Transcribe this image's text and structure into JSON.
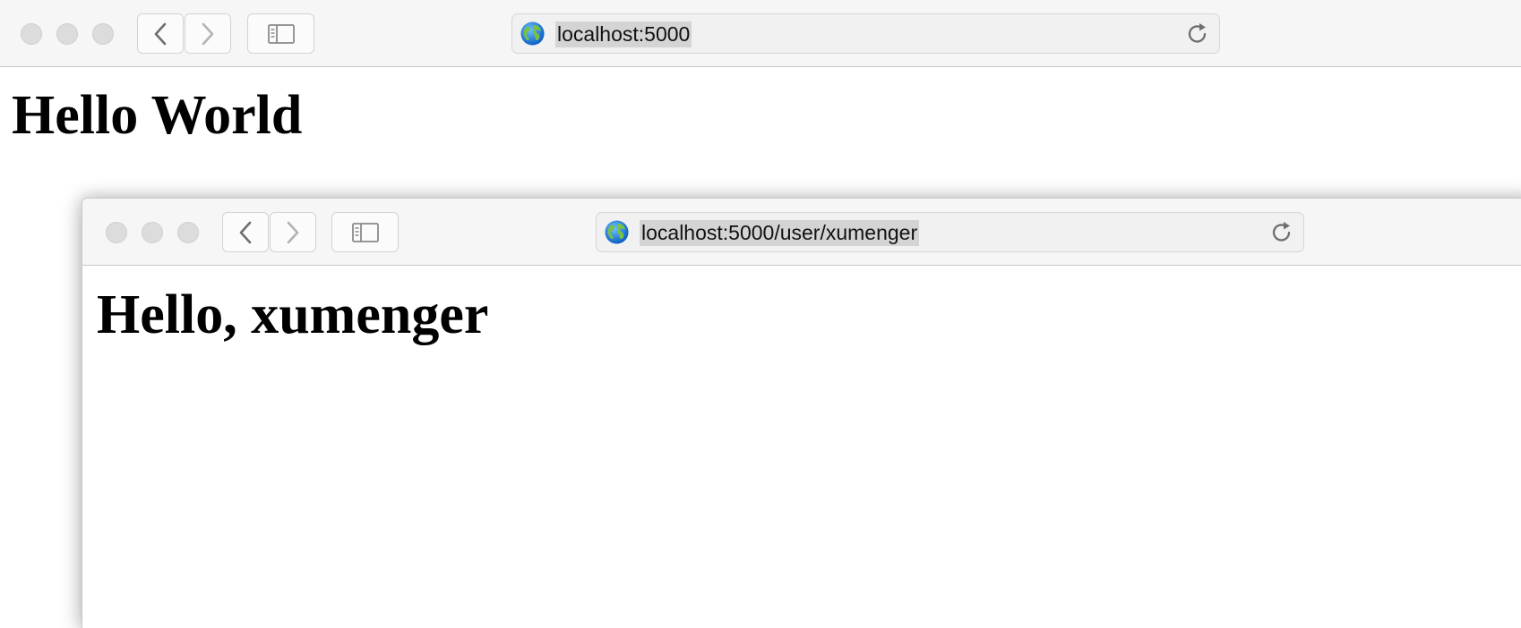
{
  "back_window": {
    "address_bar": {
      "url": "localhost:5000"
    },
    "page": {
      "heading": "Hello World"
    }
  },
  "front_window": {
    "address_bar": {
      "url": "localhost:5000/user/xumenger"
    },
    "page": {
      "heading": "Hello, xumenger"
    }
  },
  "colors": {
    "toolbar_bg": "#f6f6f6",
    "traffic_light": "#dcdcdc",
    "url_selection": "#d4d4d4",
    "page_bg": "#ffffff"
  },
  "icons": [
    "back-arrow-icon",
    "forward-arrow-icon",
    "sidebar-icon",
    "globe-icon",
    "reload-icon"
  ]
}
